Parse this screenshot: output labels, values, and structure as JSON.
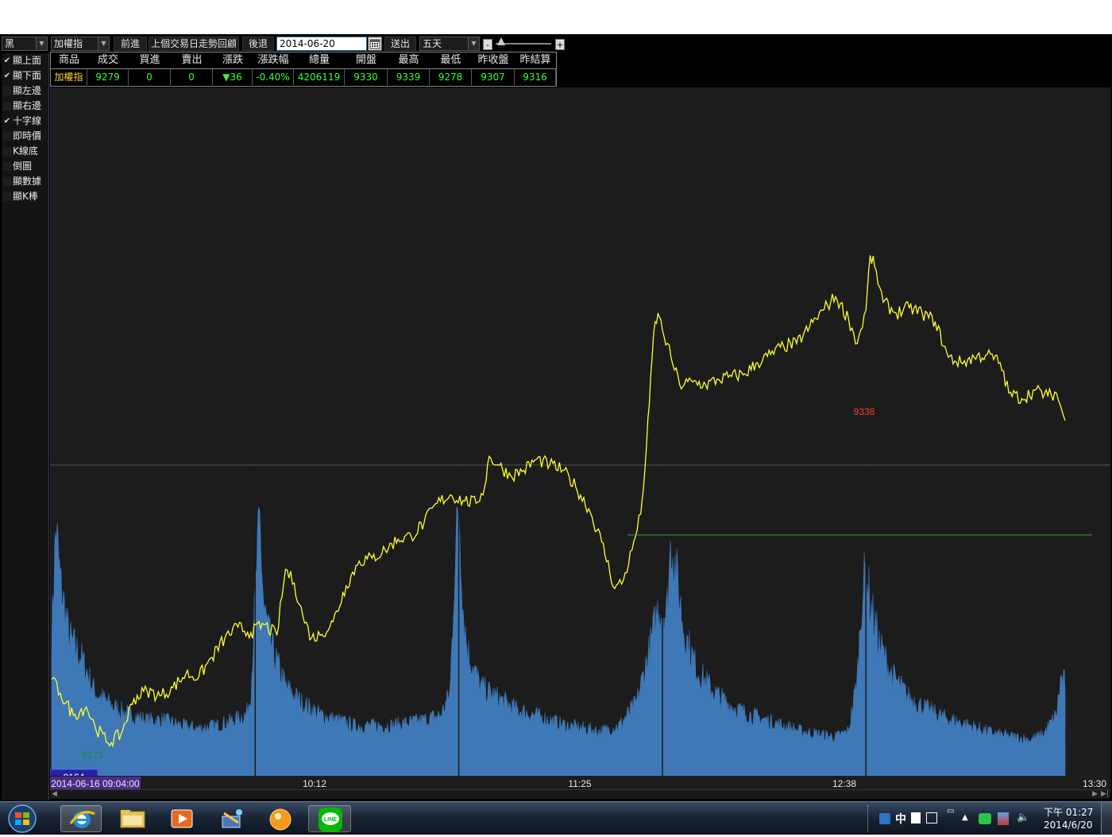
{
  "toolbar": {
    "color_select": "黑",
    "product_select": "加權指",
    "forward_btn": "前進",
    "review_btn": "上個交易日走勢回顧",
    "back_btn": "後退",
    "date_value": "2014-06-20",
    "send_btn": "送出",
    "range_select": "五天",
    "zoom_out": "-",
    "zoom_in": "+",
    "zoom_level": 0.05
  },
  "options": [
    {
      "label": "顯上面",
      "checked": true
    },
    {
      "label": "顯下面",
      "checked": true
    },
    {
      "label": "顯左邊",
      "checked": false
    },
    {
      "label": "顯右邊",
      "checked": false
    },
    {
      "label": "十字線",
      "checked": true
    },
    {
      "label": "即時價",
      "checked": false
    },
    {
      "label": "K線底",
      "checked": false
    },
    {
      "label": "倒圖",
      "checked": false
    },
    {
      "label": "顯數據",
      "checked": false
    },
    {
      "label": "顯K棒",
      "checked": false
    }
  ],
  "quote": {
    "headers": [
      "商品",
      "成交",
      "買進",
      "賣出",
      "漲跌",
      "漲跌幅",
      "總量",
      "開盤",
      "最高",
      "最低",
      "昨收盤",
      "昨結算"
    ],
    "values": [
      "加權指",
      "9279",
      "0",
      "0",
      "▼36",
      "-0.40%",
      "4206119",
      "9330",
      "9339",
      "9278",
      "9307",
      "9316"
    ]
  },
  "chart_data": {
    "type": "line",
    "x_labels": [
      "2014-06-16 09:04:00",
      "10:12",
      "11:25",
      "12:38",
      "13:30"
    ],
    "annotations": {
      "high": "9338",
      "low": "9173",
      "crosshair_price": "9164"
    },
    "price_series": [
      [
        0,
        9185
      ],
      [
        2,
        9180
      ],
      [
        5,
        9172
      ],
      [
        8,
        9175
      ],
      [
        10,
        9168
      ],
      [
        13,
        9162
      ],
      [
        16,
        9165
      ],
      [
        19,
        9178
      ],
      [
        22,
        9181
      ],
      [
        25,
        9179
      ],
      [
        28,
        9182
      ],
      [
        31,
        9187
      ],
      [
        34,
        9186
      ],
      [
        37,
        9193
      ],
      [
        40,
        9200
      ],
      [
        43,
        9204
      ],
      [
        46,
        9202
      ],
      [
        49,
        9205
      ],
      [
        52,
        9201
      ],
      [
        54,
        9225
      ],
      [
        56,
        9220
      ],
      [
        58,
        9208
      ],
      [
        60,
        9200
      ],
      [
        62,
        9201
      ],
      [
        65,
        9206
      ],
      [
        68,
        9219
      ],
      [
        71,
        9228
      ],
      [
        74,
        9229
      ],
      [
        77,
        9232
      ],
      [
        80,
        9236
      ],
      [
        83,
        9237
      ],
      [
        86,
        9242
      ],
      [
        89,
        9249
      ],
      [
        92,
        9252
      ],
      [
        95,
        9250
      ],
      [
        98,
        9249
      ],
      [
        100,
        9255
      ],
      [
        101,
        9266
      ],
      [
        103,
        9263
      ],
      [
        106,
        9259
      ],
      [
        109,
        9261
      ],
      [
        112,
        9265
      ],
      [
        115,
        9263
      ],
      [
        118,
        9261
      ],
      [
        121,
        9255
      ],
      [
        124,
        9247
      ],
      [
        127,
        9235
      ],
      [
        130,
        9218
      ],
      [
        132,
        9221
      ],
      [
        134,
        9232
      ],
      [
        136,
        9245
      ],
      [
        137,
        9262
      ],
      [
        138,
        9285
      ],
      [
        139,
        9311
      ],
      [
        140,
        9318
      ],
      [
        141,
        9312
      ],
      [
        143,
        9302
      ],
      [
        145,
        9292
      ],
      [
        148,
        9293
      ],
      [
        151,
        9292
      ],
      [
        154,
        9294
      ],
      [
        157,
        9295
      ],
      [
        160,
        9296
      ],
      [
        163,
        9300
      ],
      [
        166,
        9303
      ],
      [
        169,
        9306
      ],
      [
        172,
        9307
      ],
      [
        175,
        9313
      ],
      [
        178,
        9319
      ],
      [
        181,
        9324
      ],
      [
        184,
        9316
      ],
      [
        186,
        9307
      ],
      [
        188,
        9319
      ],
      [
        189,
        9339
      ],
      [
        190,
        9335
      ],
      [
        192,
        9322
      ],
      [
        195,
        9318
      ],
      [
        198,
        9320
      ],
      [
        201,
        9318
      ],
      [
        204,
        9315
      ],
      [
        207,
        9302
      ],
      [
        210,
        9300
      ],
      [
        213,
        9302
      ],
      [
        216,
        9303
      ],
      [
        219,
        9300
      ],
      [
        221,
        9289
      ],
      [
        224,
        9287
      ],
      [
        227,
        9290
      ],
      [
        230,
        9288
      ],
      [
        232,
        9289
      ],
      [
        234,
        9279
      ]
    ],
    "volume_series": [
      [
        0,
        0.5
      ],
      [
        1,
        0.9
      ],
      [
        2,
        0.7
      ],
      [
        4,
        0.5
      ],
      [
        7,
        0.42
      ],
      [
        10,
        0.3
      ],
      [
        14,
        0.25
      ],
      [
        18,
        0.22
      ],
      [
        22,
        0.2
      ],
      [
        26,
        0.2
      ],
      [
        30,
        0.18
      ],
      [
        34,
        0.17
      ],
      [
        38,
        0.18
      ],
      [
        42,
        0.2
      ],
      [
        45,
        0.22
      ],
      [
        46,
        0.3
      ],
      [
        47,
        0.65
      ],
      [
        48,
        0.92
      ],
      [
        49,
        0.6
      ],
      [
        51,
        0.45
      ],
      [
        54,
        0.32
      ],
      [
        58,
        0.26
      ],
      [
        62,
        0.22
      ],
      [
        66,
        0.2
      ],
      [
        70,
        0.18
      ],
      [
        74,
        0.18
      ],
      [
        78,
        0.18
      ],
      [
        82,
        0.19
      ],
      [
        86,
        0.2
      ],
      [
        90,
        0.22
      ],
      [
        92,
        0.3
      ],
      [
        93,
        0.72
      ],
      [
        94,
        1.0
      ],
      [
        95,
        0.6
      ],
      [
        96,
        0.45
      ],
      [
        99,
        0.32
      ],
      [
        103,
        0.28
      ],
      [
        107,
        0.24
      ],
      [
        111,
        0.22
      ],
      [
        115,
        0.2
      ],
      [
        119,
        0.18
      ],
      [
        123,
        0.17
      ],
      [
        127,
        0.16
      ],
      [
        131,
        0.18
      ],
      [
        135,
        0.26
      ],
      [
        138,
        0.45
      ],
      [
        140,
        0.6
      ],
      [
        142,
        0.58
      ],
      [
        143,
        0.85
      ],
      [
        144,
        0.75
      ],
      [
        146,
        0.52
      ],
      [
        149,
        0.38
      ],
      [
        153,
        0.3
      ],
      [
        157,
        0.25
      ],
      [
        161,
        0.22
      ],
      [
        165,
        0.2
      ],
      [
        169,
        0.18
      ],
      [
        173,
        0.16
      ],
      [
        177,
        0.15
      ],
      [
        181,
        0.14
      ],
      [
        184,
        0.16
      ],
      [
        186,
        0.35
      ],
      [
        187,
        0.62
      ],
      [
        188,
        0.75
      ],
      [
        189,
        0.62
      ],
      [
        191,
        0.48
      ],
      [
        194,
        0.36
      ],
      [
        198,
        0.28
      ],
      [
        202,
        0.24
      ],
      [
        206,
        0.21
      ],
      [
        210,
        0.19
      ],
      [
        214,
        0.17
      ],
      [
        218,
        0.15
      ],
      [
        222,
        0.14
      ],
      [
        226,
        0.13
      ],
      [
        229,
        0.15
      ],
      [
        232,
        0.22
      ],
      [
        233,
        0.35
      ],
      [
        234,
        0.33
      ]
    ],
    "session_dividers": [
      47,
      94,
      141,
      188
    ],
    "colors": {
      "price": "#ffff33",
      "volume": "#3e78b6",
      "high_label": "#ff3b2f",
      "low_label": "#138a36",
      "hline": "#23a847",
      "crosshair": "#1c2ea8",
      "background": "#1c1c1c"
    }
  },
  "taskbar": {
    "clock_time": "下午 01:27",
    "clock_date": "2014/6/20",
    "ime_label": "中",
    "line_label": "LINE"
  }
}
